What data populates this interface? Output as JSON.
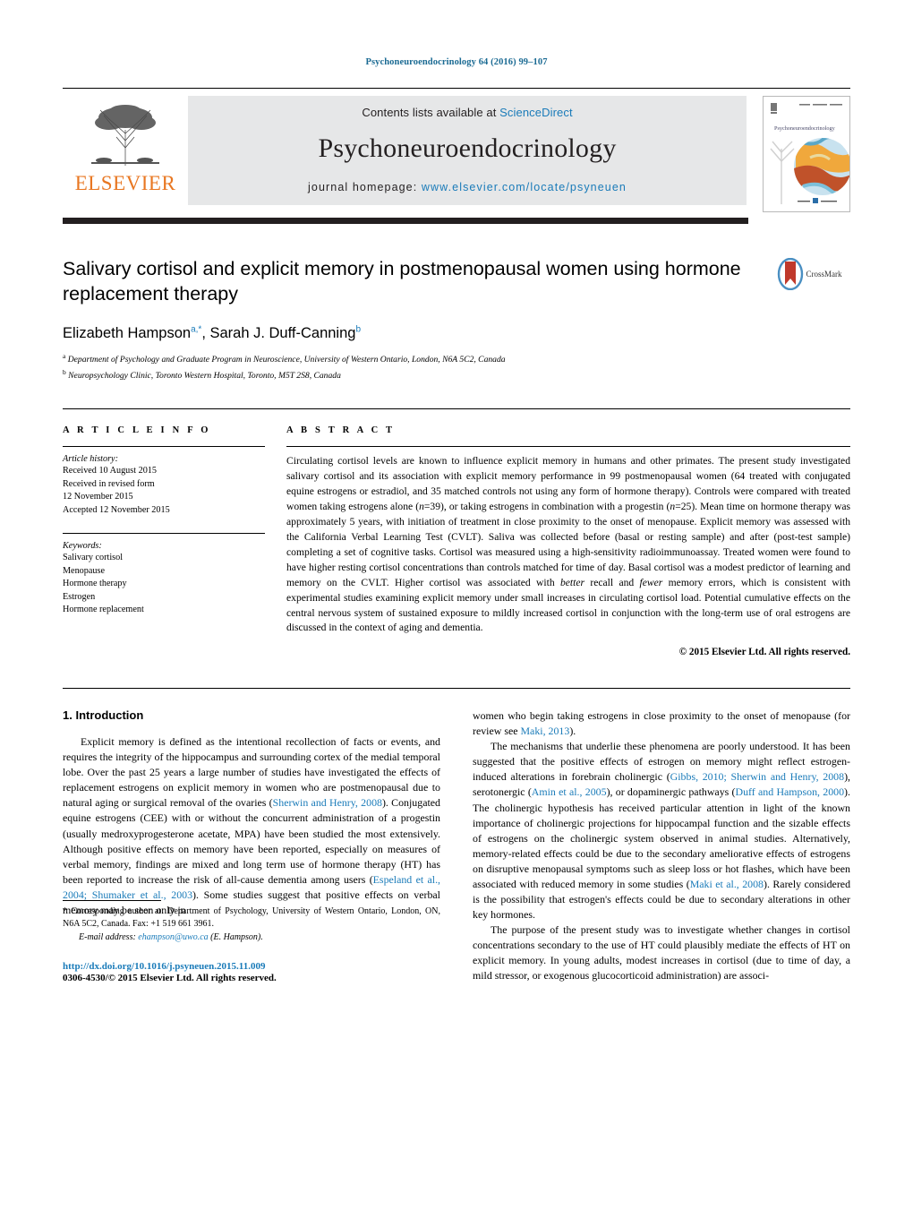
{
  "running_head": "Psychoneuroendocrinology 64 (2016) 99–107",
  "masthead": {
    "contents_prefix": "Contents lists available at ",
    "sciencedirect": "ScienceDirect",
    "journal_name": "Psychoneuroendocrinology",
    "homepage_prefix": "journal homepage: ",
    "homepage_url": "www.elsevier.com/locate/psyneuen",
    "publisher": "ELSEVIER",
    "cover_journal_title": "Psychoneuroendocrinology",
    "accent_orange": "#E87722",
    "link_blue": "#1a7bb9"
  },
  "article": {
    "title": "Salivary cortisol and explicit memory in postmenopausal women using hormone replacement therapy",
    "authors_html": "Elizabeth Hampson<sup>a,*</sup>, Sarah J. Duff-Canning<sup>b</sup>",
    "affiliation_a": "Department of Psychology and Graduate Program in Neuroscience, University of Western Ontario, London, N6A 5C2, Canada",
    "affiliation_b": "Neuropsychology Clinic, Toronto Western Hospital, Toronto, M5T 2S8, Canada",
    "crossmark_label": "CrossMark"
  },
  "article_info": {
    "heading": "A R T I C L E   I N F O",
    "history_label": "Article history:",
    "history": [
      "Received 10 August 2015",
      "Received in revised form",
      "12 November 2015",
      "Accepted 12 November 2015"
    ],
    "keywords_label": "Keywords:",
    "keywords": [
      "Salivary cortisol",
      "Menopause",
      "Hormone therapy",
      "Estrogen",
      "Hormone replacement"
    ]
  },
  "abstract": {
    "heading": "A B S T R A C T",
    "body_html": "Circulating cortisol levels are known to influence explicit memory in humans and other primates. The present study investigated salivary cortisol and its association with explicit memory performance in 99 postmenopausal women (64 treated with conjugated equine estrogens or estradiol, and 35 matched controls not using any form of hormone therapy). Controls were compared with treated women taking estrogens alone (<i>n</i>=39), or taking estrogens in combination with a progestin (<i>n</i>=25). Mean time on hormone therapy was approximately 5 years, with initiation of treatment in close proximity to the onset of menopause. Explicit memory was assessed with the California Verbal Learning Test (CVLT). Saliva was collected before (basal or resting sample) and after (post-test sample) completing a set of cognitive tasks. Cortisol was measured using a high-sensitivity radioimmunoassay. Treated women were found to have higher resting cortisol concentrations than controls matched for time of day. Basal cortisol was a modest predictor of learning and memory on the CVLT. Higher cortisol was associated with <i>better</i> recall and <i>fewer</i> memory errors, which is consistent with experimental studies examining explicit memory under small increases in circulating cortisol load. Potential cumulative effects on the central nervous system of sustained exposure to mildly increased cortisol in conjunction with the long-term use of oral estrogens are discussed in the context of aging and dementia.",
    "copyright": "© 2015 Elsevier Ltd. All rights reserved."
  },
  "introduction": {
    "heading": "1.  Introduction",
    "left_p1_html": "Explicit memory is defined as the intentional recollection of facts or events, and requires the integrity of the hippocampus and surrounding cortex of the medial temporal lobe. Over the past 25 years a large number of studies have investigated the effects of replacement estrogens on explicit memory in women who are postmenopausal due to natural aging or surgical removal of the ovaries (<span class=\"ref\">Sherwin and Henry, 2008</span>). Conjugated equine estrogens (CEE) with or without the concurrent administration of a progestin (usually medroxyprogesterone acetate, MPA) have been studied the most extensively. Although positive effects on memory have been reported, especially on measures of verbal memory, findings are mixed and long term use of hormone therapy (HT) has been reported to increase the risk of all-cause dementia among users (<span class=\"ref\">Espeland et al., 2004; Shumaker et al., 2003</span>). Some studies suggest that positive effects on verbal memory may be seen only in",
    "right_p1_html": "women who begin taking estrogens in close proximity to the onset of menopause (for review see <span class=\"ref\">Maki, 2013</span>).",
    "right_p2_html": "The mechanisms that underlie these phenomena are poorly understood. It has been suggested that the positive effects of estrogen on memory might reflect estrogen-induced alterations in forebrain cholinergic (<span class=\"ref\">Gibbs, 2010; Sherwin and Henry, 2008</span>), serotonergic (<span class=\"ref\">Amin et al., 2005</span>), or dopaminergic pathways (<span class=\"ref\">Duff and Hampson, 2000</span>). The cholinergic hypothesis has received particular attention in light of the known importance of cholinergic projections for hippocampal function and the sizable effects of estrogens on the cholinergic system observed in animal studies. Alternatively, memory-related effects could be due to the secondary ameliorative effects of estrogens on disruptive menopausal symptoms such as sleep loss or hot flashes, which have been associated with reduced memory in some studies (<span class=\"ref\">Maki et al., 2008</span>). Rarely considered is the possibility that estrogen's effects could be due to secondary alterations in other key hormones.",
    "right_p3_html": "The purpose of the present study was to investigate whether changes in cortisol concentrations secondary to the use of HT could plausibly mediate the effects of HT on explicit memory. In young adults, modest increases in cortisol (due to time of day, a mild stressor, or exogenous glucocorticoid administration) are associ-"
  },
  "footnote": {
    "corresponding_html": "<span class=\"ind\">*  Corresponding author at: Department of Psychology, University of Western Ontario, London, ON, N6A 5C2, Canada. Fax: +1 519 661 3961.</span>",
    "email_label": "E-mail address:",
    "email": "ehampson@uwo.ca",
    "email_suffix": "(E. Hampson).",
    "doi": "http://dx.doi.org/10.1016/j.psyneuen.2015.11.009",
    "issn": "0306-4530/© 2015 Elsevier Ltd. All rights reserved."
  }
}
